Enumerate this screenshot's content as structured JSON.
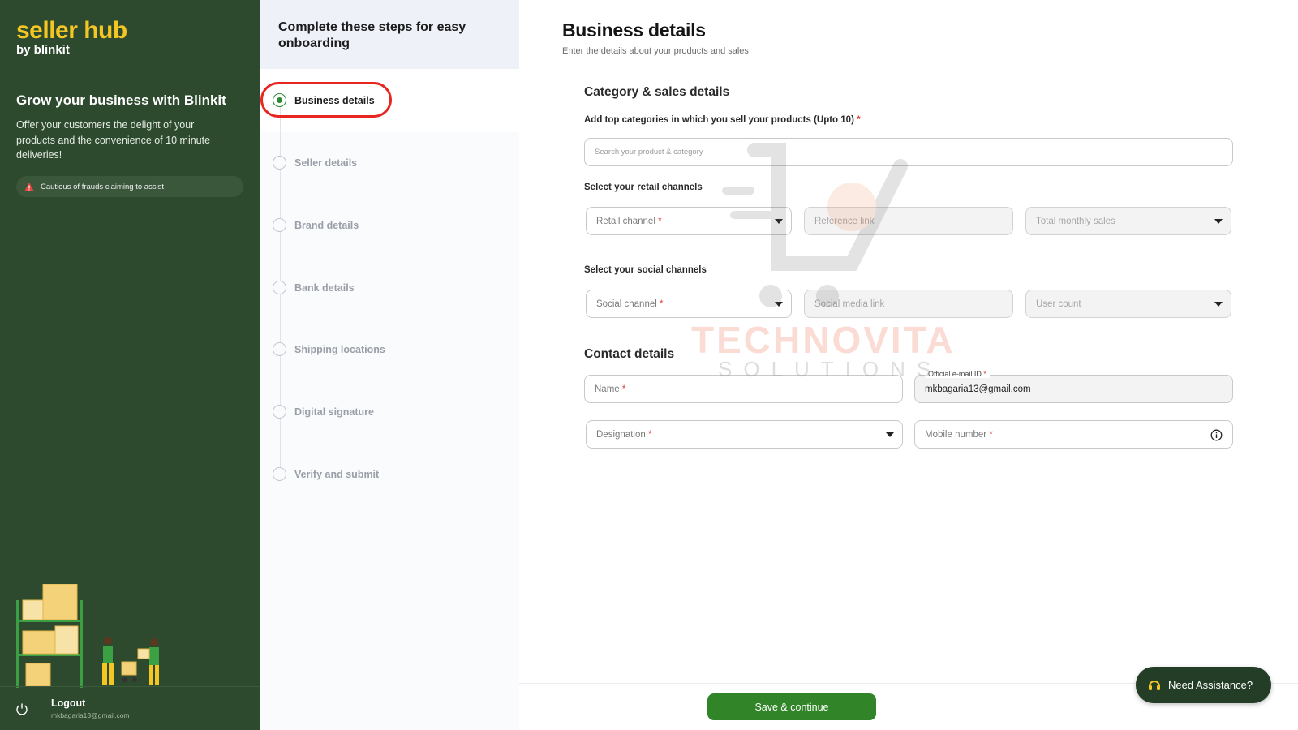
{
  "brand": {
    "name": "seller hub",
    "by": "by blinkit"
  },
  "sidebar": {
    "title": "Grow your business with Blinkit",
    "description": "Offer your customers the delight of your products and the convenience of 10 minute deliveries!",
    "fraud_notice": "Cautious of frauds claiming to assist!",
    "logout_label": "Logout",
    "logout_email": "mkbagaria13@gmail.com"
  },
  "steps": {
    "header": "Complete these steps for easy onboarding",
    "items": [
      {
        "label": "Business details",
        "active": true
      },
      {
        "label": "Seller details",
        "active": false
      },
      {
        "label": "Brand details",
        "active": false
      },
      {
        "label": "Bank details",
        "active": false
      },
      {
        "label": "Shipping locations",
        "active": false
      },
      {
        "label": "Digital signature",
        "active": false
      },
      {
        "label": "Verify and submit",
        "active": false
      }
    ]
  },
  "form": {
    "title": "Business details",
    "subtitle": "Enter the details about your products and sales",
    "category_section": "Category & sales details",
    "categories_label": "Add top categories in which you sell your products (Upto 10)",
    "categories_placeholder": "Search your product & category",
    "retail_label": "Select your retail channels",
    "retail_channel": "Retail channel",
    "reference_link": "Reference link",
    "total_monthly_sales": "Total monthly sales",
    "social_label": "Select your social channels",
    "social_channel": "Social channel",
    "social_media_link": "Social media link",
    "user_count": "User count",
    "contact_section": "Contact details",
    "name": "Name",
    "email_label": "Official e-mail ID",
    "email_value": "mkbagaria13@gmail.com",
    "designation": "Designation",
    "mobile": "Mobile number",
    "required_mark": "*"
  },
  "footer": {
    "save_label": "Save & continue",
    "assist_label": "Need Assistance?"
  },
  "watermark": {
    "text": "TECHNOVITA",
    "sub": "SOLUTIONS"
  },
  "colors": {
    "sidebar": "#2e4a2e",
    "brand_yellow": "#f3c623",
    "primary_green": "#318428",
    "highlight_red": "#e8251f"
  }
}
